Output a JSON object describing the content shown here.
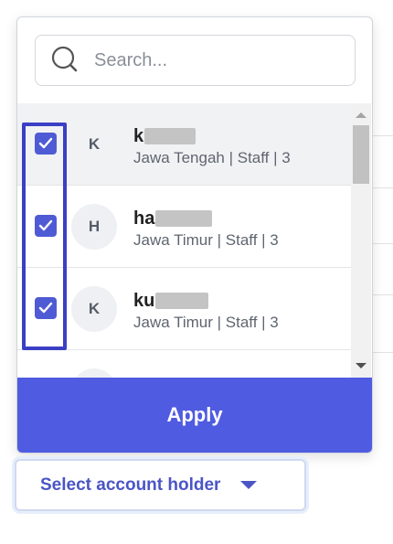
{
  "search": {
    "placeholder": "Search..."
  },
  "items": [
    {
      "initial": "K",
      "name_visible": "k",
      "meta": "Jawa Tengah | Staff | 3",
      "checked": true
    },
    {
      "initial": "H",
      "name_visible": "ha",
      "meta": "Jawa Timur | Staff | 3",
      "checked": true
    },
    {
      "initial": "K",
      "name_visible": "ku",
      "meta": "Jawa Timur | Staff | 3",
      "checked": true
    }
  ],
  "apply_label": "Apply",
  "select_label": "Select account holder",
  "colors": {
    "accent": "#4f5be0",
    "highlight": "#3a3fc4",
    "checkbox": "#4f5bd5"
  }
}
